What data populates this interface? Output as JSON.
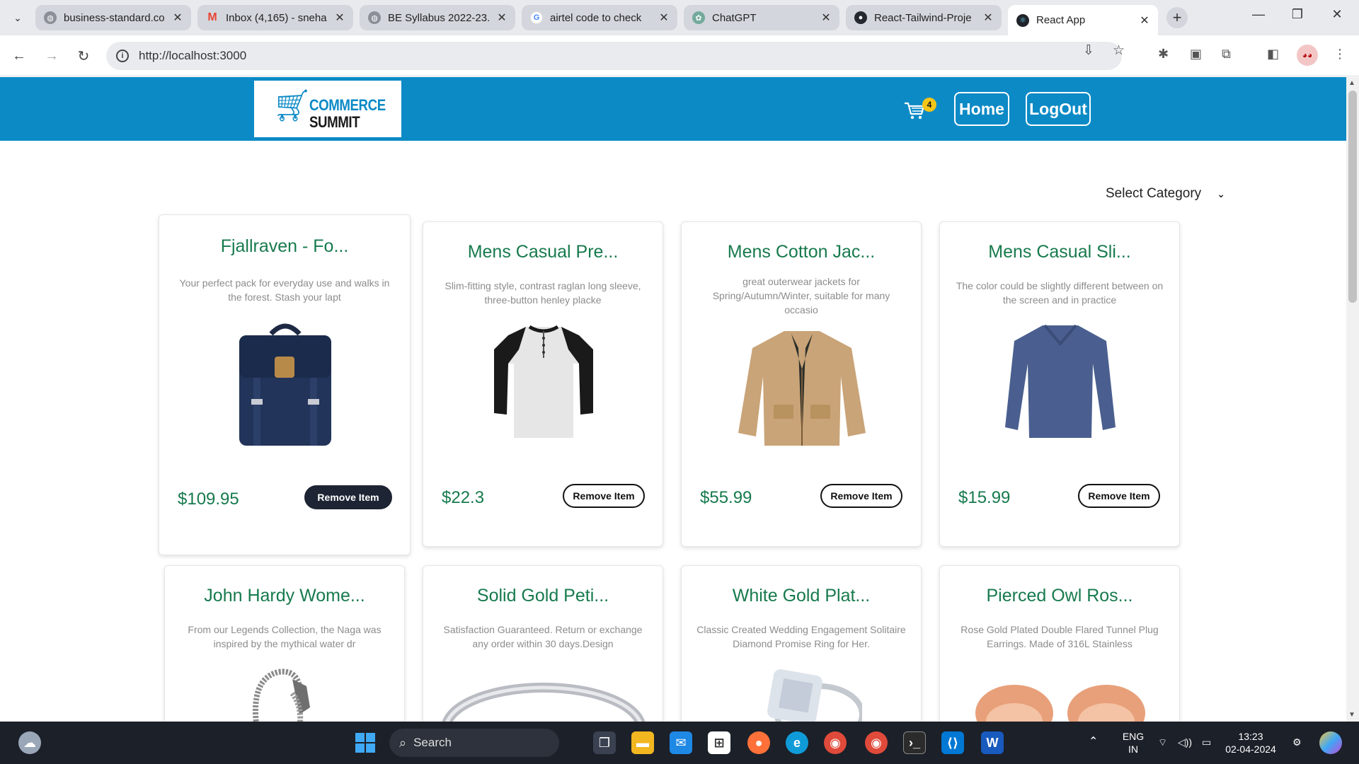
{
  "browser": {
    "tabs": [
      {
        "title": "business-standard.co",
        "favicon": "globe-icon",
        "color": "#8a8f98"
      },
      {
        "title": "Inbox (4,165) - sneha",
        "favicon": "gmail-icon",
        "color": "#ea4335"
      },
      {
        "title": "BE Syllabus 2022-23.",
        "favicon": "globe-icon",
        "color": "#8a8f98"
      },
      {
        "title": "airtel code to check",
        "favicon": "google-icon",
        "color": "#4285f4"
      },
      {
        "title": "ChatGPT",
        "favicon": "chatgpt-icon",
        "color": "#74aa9c"
      },
      {
        "title": "React-Tailwind-Proje",
        "favicon": "github-icon",
        "color": "#24292f"
      },
      {
        "title": "React App",
        "favicon": "react-icon",
        "color": "#20232a"
      }
    ],
    "active_tab": 6,
    "new_tab_symbol": "+",
    "url": "http://localhost:3000"
  },
  "app": {
    "brand_line1": "COMMERCE",
    "brand_line2": "SUMMIT",
    "cart_count": "4",
    "nav_home": "Home",
    "nav_logout": "LogOut",
    "category_label": "Select Category",
    "accent_color": "#0c8ac6",
    "title_color": "#177a4d"
  },
  "products": [
    {
      "title": "Fjallraven - Fo...",
      "description": "Your perfect pack for everyday use and walks in the forest. Stash your lapt",
      "price": "$109.95",
      "button": "Remove Item",
      "image": "backpack"
    },
    {
      "title": "Mens Casual Pre...",
      "description": "Slim-fitting style, contrast raglan long sleeve, three-button henley placke",
      "price": "$22.3",
      "button": "Remove Item",
      "image": "raglan-shirt"
    },
    {
      "title": "Mens Cotton Jac...",
      "description": "great outerwear jackets for Spring/Autumn/Winter, suitable for many occasio",
      "price": "$55.99",
      "button": "Remove Item",
      "image": "jacket"
    },
    {
      "title": "Mens Casual Sli...",
      "description": "The color could be slightly different between on the screen and in practice",
      "price": "$15.99",
      "button": "Remove Item",
      "image": "sweater"
    },
    {
      "title": "John Hardy Wome...",
      "description": "From our Legends Collection, the Naga was inspired by the mythical water dr",
      "image": "bracelet"
    },
    {
      "title": "Solid Gold Peti...",
      "description": "Satisfaction Guaranteed. Return or exchange any order within 30 days.Design",
      "image": "ring"
    },
    {
      "title": "White Gold Plat...",
      "description": "Classic Created Wedding Engagement Solitaire Diamond Promise Ring for Her.",
      "image": "diamond-ring"
    },
    {
      "title": "Pierced Owl Ros...",
      "description": "Rose Gold Plated Double Flared Tunnel Plug Earrings. Made of 316L Stainless",
      "image": "earrings"
    }
  ],
  "taskbar": {
    "search_placeholder": "Search",
    "lang_line1": "ENG",
    "lang_line2": "IN",
    "time": "13:23",
    "date": "02-04-2024"
  }
}
